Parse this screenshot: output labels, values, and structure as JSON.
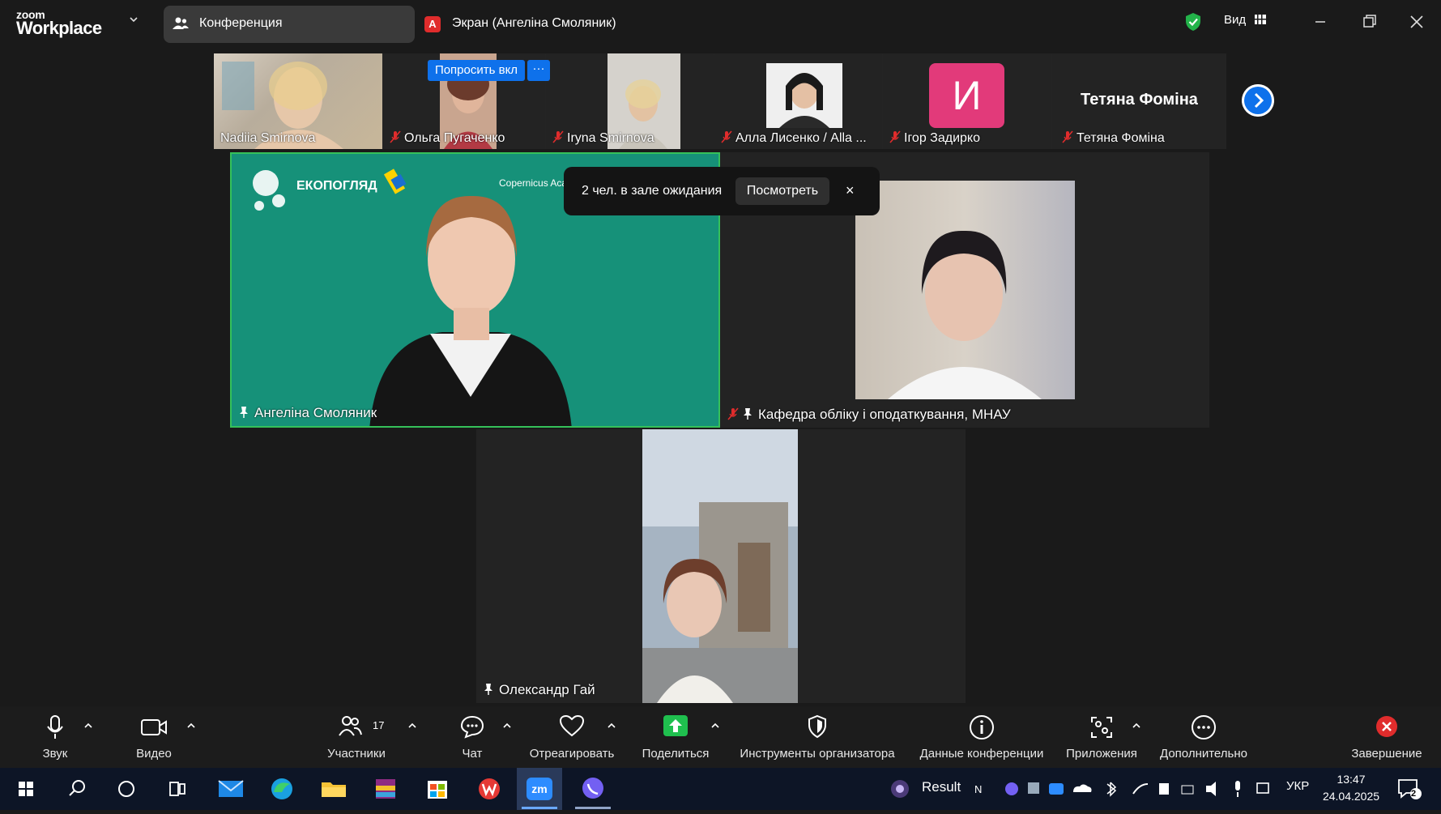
{
  "app": {
    "logo_small": "zoom",
    "logo_big": "Workplace",
    "tabs": [
      {
        "label": "Конференция",
        "active": true
      },
      {
        "label": "Экран (Ангеліна Смоляник)",
        "badge": "A"
      }
    ],
    "view_label": "Вид",
    "accent": "#0e71eb",
    "secure_color": "#23b34a"
  },
  "strip": {
    "participants": [
      {
        "name": "Nadiia Smirnova",
        "muted": false
      },
      {
        "name": "Ольга Пугаченко",
        "muted": true
      },
      {
        "name": "Iryna Smirnova",
        "muted": true
      },
      {
        "name": "Алла Лисенко / Alla ...",
        "muted": true
      },
      {
        "name": "Ігор Задирко",
        "muted": true,
        "avatar_letter": "И",
        "avatar_color": "#e23a7a"
      },
      {
        "name": "Тетяна Фоміна",
        "muted": true,
        "display_name": "Тетяна Фоміна"
      }
    ],
    "ask_button": "Попросить вкл",
    "more_button": "···"
  },
  "gallery": {
    "speaker": {
      "name": "Ангеліна Смоляник",
      "pinned": true,
      "bg_text_1": "ЕКОПОГЛЯД",
      "bg_text_2": "Copernicus Academy"
    },
    "second": {
      "name": "Кафедра обліку і оподаткування, МНАУ",
      "pinned": true,
      "muted": true
    },
    "third": {
      "name": "Олександр Гай",
      "pinned": true
    }
  },
  "waiting_room": {
    "text": "2 чел. в зале ожидания",
    "button": "Посмотреть",
    "close": "×"
  },
  "toolbar": {
    "audio": "Звук",
    "video": "Видео",
    "participants": "Участники",
    "participants_count": "17",
    "chat": "Чат",
    "react": "Отреагировать",
    "share": "Поделиться",
    "host_tools": "Инструменты организатора",
    "meeting_info": "Данные конференции",
    "apps": "Приложения",
    "more": "Дополнительно",
    "end": "Завершение"
  },
  "taskbar": {
    "tray_app": "Result",
    "lang": "УКР",
    "time": "13:47",
    "date": "24.04.2025",
    "notifications": "2"
  }
}
